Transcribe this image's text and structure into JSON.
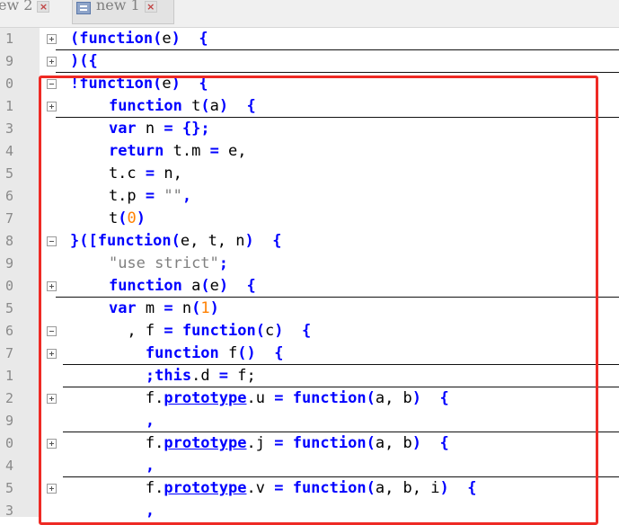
{
  "tabs": [
    {
      "label": "ew 2",
      "active": false
    },
    {
      "label": "new 1",
      "active": true
    }
  ],
  "line_numbers": [
    "1",
    "9",
    "0",
    "1",
    "3",
    "4",
    "5",
    "6",
    "7",
    "8",
    "9",
    "0",
    "5",
    "6",
    "7",
    "1",
    "2",
    "9",
    "0",
    "4",
    "5",
    "3"
  ],
  "code_lines": [
    [
      {
        "t": "(",
        "c": "kw"
      },
      {
        "t": "function",
        "c": "kw"
      },
      {
        "t": "(",
        "c": "kw"
      },
      {
        "t": "e",
        "c": "txt"
      },
      {
        "t": ")  {",
        "c": "kw"
      }
    ],
    [
      {
        "t": ")({",
        "c": "kw"
      }
    ],
    [
      {
        "t": "!function",
        "c": "kw"
      },
      {
        "t": "(",
        "c": "kw"
      },
      {
        "t": "e",
        "c": "txt"
      },
      {
        "t": ")  {",
        "c": "kw"
      }
    ],
    [
      {
        "t": "    ",
        "c": "txt"
      },
      {
        "t": "function",
        "c": "kw"
      },
      {
        "t": " t",
        "c": "txt"
      },
      {
        "t": "(",
        "c": "kw"
      },
      {
        "t": "a",
        "c": "txt"
      },
      {
        "t": ")  {",
        "c": "kw"
      }
    ],
    [
      {
        "t": "    ",
        "c": "txt"
      },
      {
        "t": "var",
        "c": "kw"
      },
      {
        "t": " n ",
        "c": "txt"
      },
      {
        "t": "=",
        "c": "kw"
      },
      {
        "t": " ",
        "c": "txt"
      },
      {
        "t": "{};",
        "c": "kw"
      }
    ],
    [
      {
        "t": "    ",
        "c": "txt"
      },
      {
        "t": "return",
        "c": "kw"
      },
      {
        "t": " t.m ",
        "c": "txt"
      },
      {
        "t": "=",
        "c": "kw"
      },
      {
        "t": " e,",
        "c": "txt"
      }
    ],
    [
      {
        "t": "    t.c ",
        "c": "txt"
      },
      {
        "t": "=",
        "c": "kw"
      },
      {
        "t": " n,",
        "c": "txt"
      }
    ],
    [
      {
        "t": "    t.p ",
        "c": "txt"
      },
      {
        "t": "=",
        "c": "kw"
      },
      {
        "t": " ",
        "c": "txt"
      },
      {
        "t": "\"\"",
        "c": "str"
      },
      {
        "t": ",",
        "c": "kw"
      }
    ],
    [
      {
        "t": "    t",
        "c": "txt"
      },
      {
        "t": "(",
        "c": "kw"
      },
      {
        "t": "0",
        "c": "num"
      },
      {
        "t": ")",
        "c": "kw"
      }
    ],
    [
      {
        "t": "}([",
        "c": "kw"
      },
      {
        "t": "function",
        "c": "kw"
      },
      {
        "t": "(",
        "c": "kw"
      },
      {
        "t": "e, t, n",
        "c": "txt"
      },
      {
        "t": ")  {",
        "c": "kw"
      }
    ],
    [
      {
        "t": "    ",
        "c": "txt"
      },
      {
        "t": "\"use strict\"",
        "c": "str"
      },
      {
        "t": ";",
        "c": "kw"
      }
    ],
    [
      {
        "t": "    ",
        "c": "txt"
      },
      {
        "t": "function",
        "c": "kw"
      },
      {
        "t": " a",
        "c": "txt"
      },
      {
        "t": "(",
        "c": "kw"
      },
      {
        "t": "e",
        "c": "txt"
      },
      {
        "t": ")  {",
        "c": "kw"
      }
    ],
    [
      {
        "t": "    ",
        "c": "txt"
      },
      {
        "t": "var",
        "c": "kw"
      },
      {
        "t": " m ",
        "c": "txt"
      },
      {
        "t": "=",
        "c": "kw"
      },
      {
        "t": " n",
        "c": "txt"
      },
      {
        "t": "(",
        "c": "kw"
      },
      {
        "t": "1",
        "c": "num"
      },
      {
        "t": ")",
        "c": "kw"
      }
    ],
    [
      {
        "t": "      , f ",
        "c": "txt"
      },
      {
        "t": "=",
        "c": "kw"
      },
      {
        "t": " ",
        "c": "txt"
      },
      {
        "t": "function",
        "c": "kw"
      },
      {
        "t": "(",
        "c": "kw"
      },
      {
        "t": "c",
        "c": "txt"
      },
      {
        "t": ")  {",
        "c": "kw"
      }
    ],
    [
      {
        "t": "        ",
        "c": "txt"
      },
      {
        "t": "function",
        "c": "kw"
      },
      {
        "t": " f",
        "c": "txt"
      },
      {
        "t": "()  {",
        "c": "kw"
      }
    ],
    [
      {
        "t": "        ",
        "c": "txt"
      },
      {
        "t": ";this",
        "c": "kw"
      },
      {
        "t": ".d ",
        "c": "txt"
      },
      {
        "t": "=",
        "c": "kw"
      },
      {
        "t": " f;",
        "c": "txt"
      }
    ],
    [
      {
        "t": "        f.",
        "c": "txt"
      },
      {
        "t": "prototype",
        "c": "kw ul"
      },
      {
        "t": ".u ",
        "c": "txt"
      },
      {
        "t": "=",
        "c": "kw"
      },
      {
        "t": " ",
        "c": "txt"
      },
      {
        "t": "function",
        "c": "kw"
      },
      {
        "t": "(",
        "c": "kw"
      },
      {
        "t": "a, b",
        "c": "txt"
      },
      {
        "t": ")  {",
        "c": "kw"
      }
    ],
    [
      {
        "t": "        ,",
        "c": "kw"
      }
    ],
    [
      {
        "t": "        f.",
        "c": "txt"
      },
      {
        "t": "prototype",
        "c": "kw ul"
      },
      {
        "t": ".j ",
        "c": "txt"
      },
      {
        "t": "=",
        "c": "kw"
      },
      {
        "t": " ",
        "c": "txt"
      },
      {
        "t": "function",
        "c": "kw"
      },
      {
        "t": "(",
        "c": "kw"
      },
      {
        "t": "a, b",
        "c": "txt"
      },
      {
        "t": ")  {",
        "c": "kw"
      }
    ],
    [
      {
        "t": "        ,",
        "c": "kw"
      }
    ],
    [
      {
        "t": "        f.",
        "c": "txt"
      },
      {
        "t": "prototype",
        "c": "kw ul"
      },
      {
        "t": ".v ",
        "c": "txt"
      },
      {
        "t": "=",
        "c": "kw"
      },
      {
        "t": " ",
        "c": "txt"
      },
      {
        "t": "function",
        "c": "kw"
      },
      {
        "t": "(",
        "c": "kw"
      },
      {
        "t": "a, b, i",
        "c": "txt"
      },
      {
        "t": ")  {",
        "c": "kw"
      }
    ],
    [
      {
        "t": "        ,",
        "c": "kw"
      }
    ]
  ],
  "fold_markers": [
    "plus",
    "plus",
    "minus",
    "plus",
    "",
    "",
    "",
    "",
    "",
    "minus",
    "",
    "plus",
    "",
    "minus",
    "plus",
    "",
    "plus",
    "",
    "plus",
    "",
    "plus",
    ""
  ],
  "colors": {
    "keyword": "#0000ff",
    "string": "#808080",
    "number": "#ff8000",
    "highlight_border": "#ee2a24",
    "gutter": "#e9e9e9"
  }
}
